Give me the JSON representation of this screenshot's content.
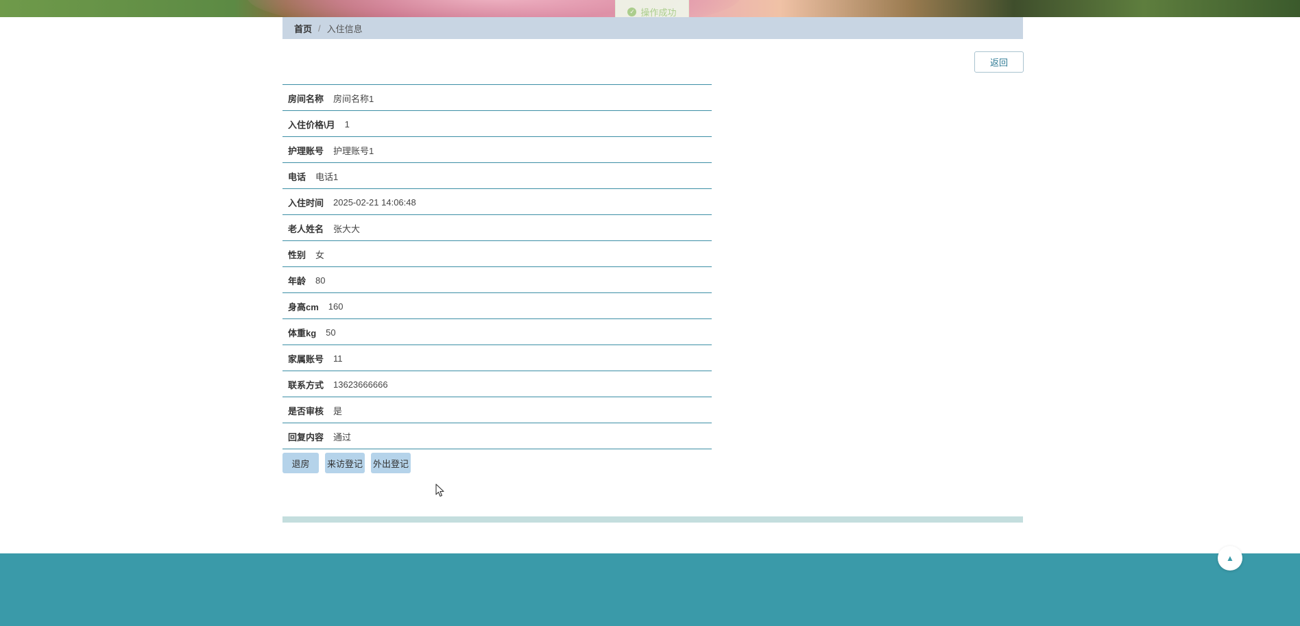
{
  "toast": {
    "message": "操作成功",
    "icon": "check-circle-icon",
    "color": "#a6d48a"
  },
  "breadcrumb": {
    "home": "首页",
    "separator": "/",
    "current": "入住信息"
  },
  "back_button": {
    "label": "返回"
  },
  "details": [
    {
      "label": "房间名称",
      "value": "房间名称1"
    },
    {
      "label": "入住价格\\月",
      "value": "1"
    },
    {
      "label": "护理账号",
      "value": "护理账号1"
    },
    {
      "label": "电话",
      "value": "电话1"
    },
    {
      "label": "入住时间",
      "value": "2025-02-21 14:06:48"
    },
    {
      "label": "老人姓名",
      "value": "张大大"
    },
    {
      "label": "性别",
      "value": "女"
    },
    {
      "label": "年龄",
      "value": "80"
    },
    {
      "label": "身高cm",
      "value": "160"
    },
    {
      "label": "体重kg",
      "value": "50"
    },
    {
      "label": "家属账号",
      "value": "11"
    },
    {
      "label": "联系方式",
      "value": "13623666666"
    },
    {
      "label": "是否审核",
      "value": "是"
    },
    {
      "label": "回复内容",
      "value": "通过"
    }
  ],
  "actions": {
    "checkout": "退房",
    "visit_register": "来访登记",
    "outing_register": "外出登记"
  },
  "scroll_top": {
    "icon": "caret-up-icon",
    "glyph": "▲"
  },
  "colors": {
    "breadcrumb_bg": "#c8d5e3",
    "row_border": "#3b8ea5",
    "action_bg": "#b5d3ea",
    "footer_bg": "#3a9aa9"
  }
}
